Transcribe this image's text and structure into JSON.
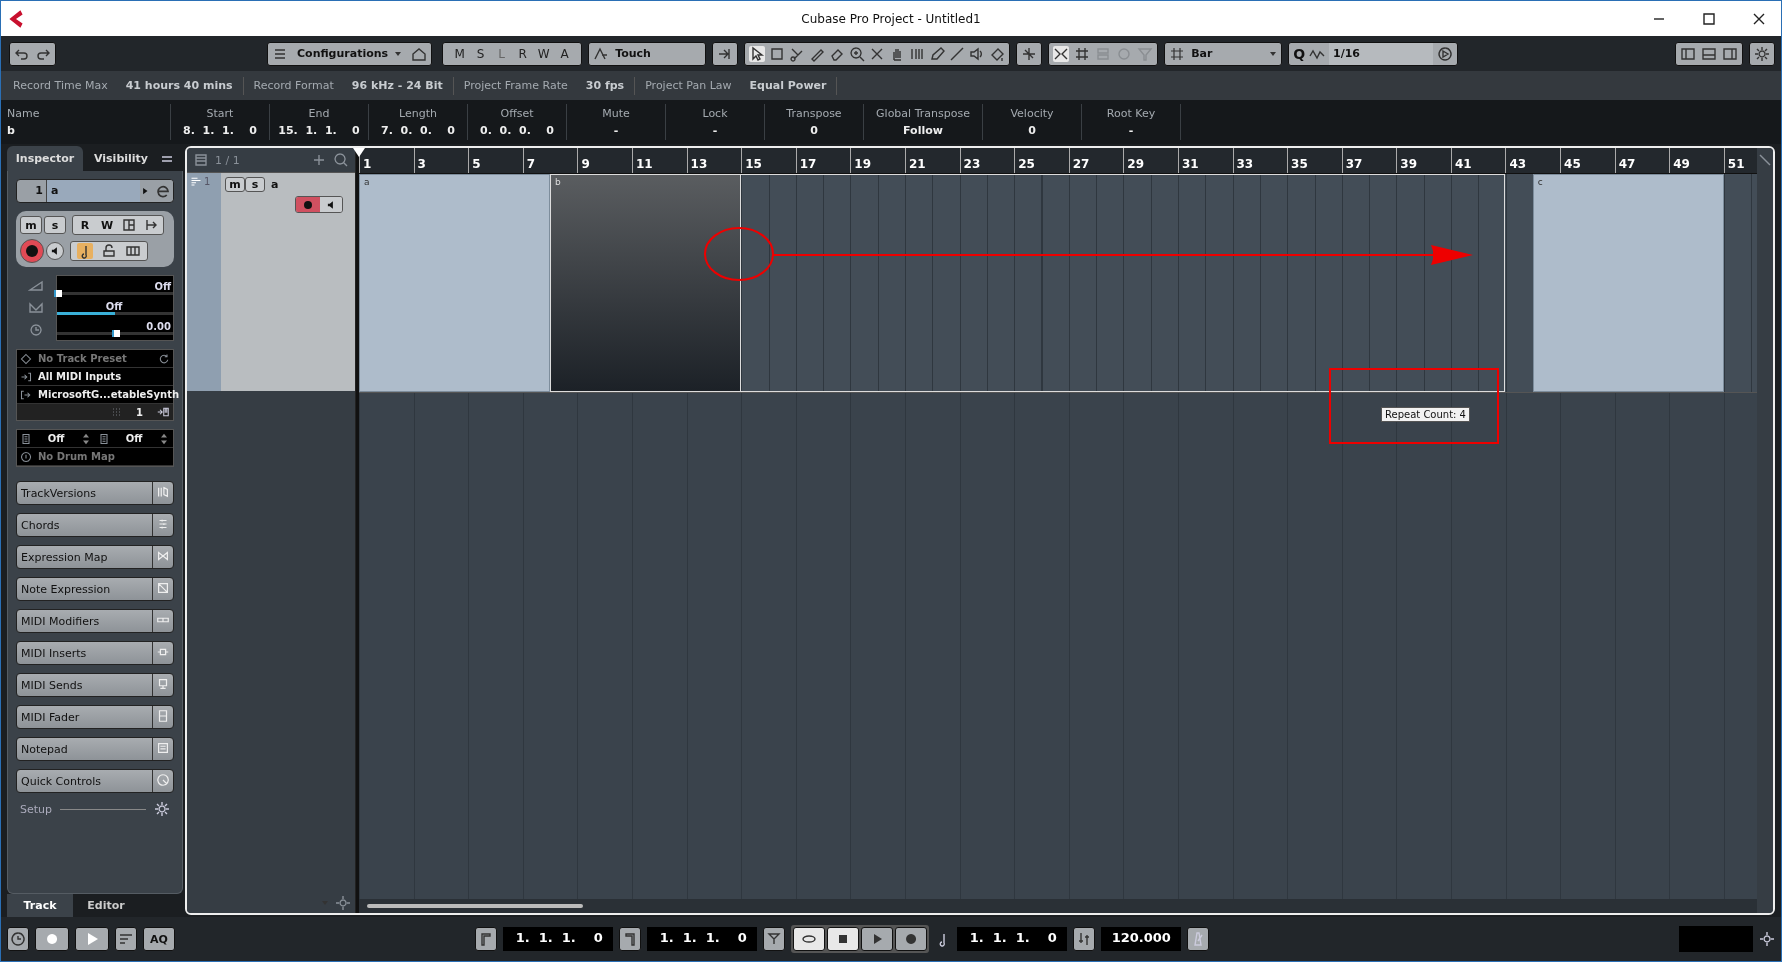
{
  "window": {
    "title": "Cubase Pro Project - Untitled1"
  },
  "toolbar": {
    "configurations": "Configurations",
    "automation_modes": [
      "M",
      "S",
      "L",
      "R",
      "W",
      "A"
    ],
    "automation_mode": "Touch",
    "grid_type": "Bar",
    "quantize_label": "Q",
    "quantize": "1/16"
  },
  "project_info": [
    {
      "label": "Record Time Max",
      "value": "41 hours 40 mins"
    },
    {
      "label": "Record Format",
      "value": "96 kHz - 24 Bit"
    },
    {
      "label": "Project Frame Rate",
      "value": "30 fps"
    },
    {
      "label": "Project Pan Law",
      "value": "Equal Power"
    }
  ],
  "event_info": [
    {
      "label": "Name",
      "value": "b"
    },
    {
      "label": "Start",
      "value": "8.  1.  1.    0"
    },
    {
      "label": "End",
      "value": "15.  1.  1.    0"
    },
    {
      "label": "Length",
      "value": "7.  0.  0.    0"
    },
    {
      "label": "Offset",
      "value": "0.  0.  0.    0"
    },
    {
      "label": "Mute",
      "value": "-"
    },
    {
      "label": "Lock",
      "value": "-"
    },
    {
      "label": "Transpose",
      "value": "0"
    },
    {
      "label": "Global Transpose",
      "value": "Follow"
    },
    {
      "label": "Velocity",
      "value": "0"
    },
    {
      "label": "Root Key",
      "value": "-"
    }
  ],
  "inspector": {
    "tabs": [
      {
        "label": "Inspector",
        "selected": true
      },
      {
        "label": "Visibility",
        "selected": false
      }
    ],
    "track_number": "1",
    "track_name": "a",
    "mute": "m",
    "solo": "s",
    "read": "R",
    "write": "W",
    "volume": {
      "reading": "Off",
      "level": 0
    },
    "pan": {
      "reading": "Off",
      "level": 0.5
    },
    "delay": {
      "reading": "0.00",
      "level": 0.5
    },
    "preset": "No Track Preset",
    "input": "All MIDI Inputs",
    "output": "MicrosoftG...etableSynth",
    "channel": "1",
    "bank": "Off",
    "program": "Off",
    "drum_map": "No Drum Map",
    "sections": [
      "TrackVersions",
      "Chords",
      "Expression Map",
      "Note Expression",
      "MIDI Modifiers",
      "MIDI Inserts",
      "MIDI Sends",
      "MIDI Fader",
      "Notepad",
      "Quick Controls"
    ],
    "setup": "Setup",
    "bottom_tabs": [
      {
        "label": "Track",
        "selected": true
      },
      {
        "label": "Editor",
        "selected": false
      }
    ]
  },
  "track_list": {
    "count": "1 / 1",
    "tracks": [
      {
        "number": "1",
        "name": "a",
        "mute": "m",
        "solo": "s"
      }
    ]
  },
  "ruler": [
    "1",
    "3",
    "5",
    "7",
    "9",
    "11",
    "13",
    "15",
    "17",
    "19",
    "21",
    "23",
    "25",
    "27",
    "29",
    "31",
    "33",
    "35",
    "37",
    "39",
    "41",
    "43",
    "45",
    "47",
    "49",
    "51"
  ],
  "events": [
    {
      "name": "a",
      "selected": false
    },
    {
      "name": "b",
      "selected": true
    },
    {
      "name": "c",
      "selected": false
    }
  ],
  "tooltip": "Repeat Count: 4",
  "transport": {
    "left_locator": "1.  1.  1.    0",
    "right_locator": "1.  1.  1.    0",
    "position": "1.  1.  1.    0",
    "tempo": "120.000",
    "auto_quantize": "AQ"
  }
}
